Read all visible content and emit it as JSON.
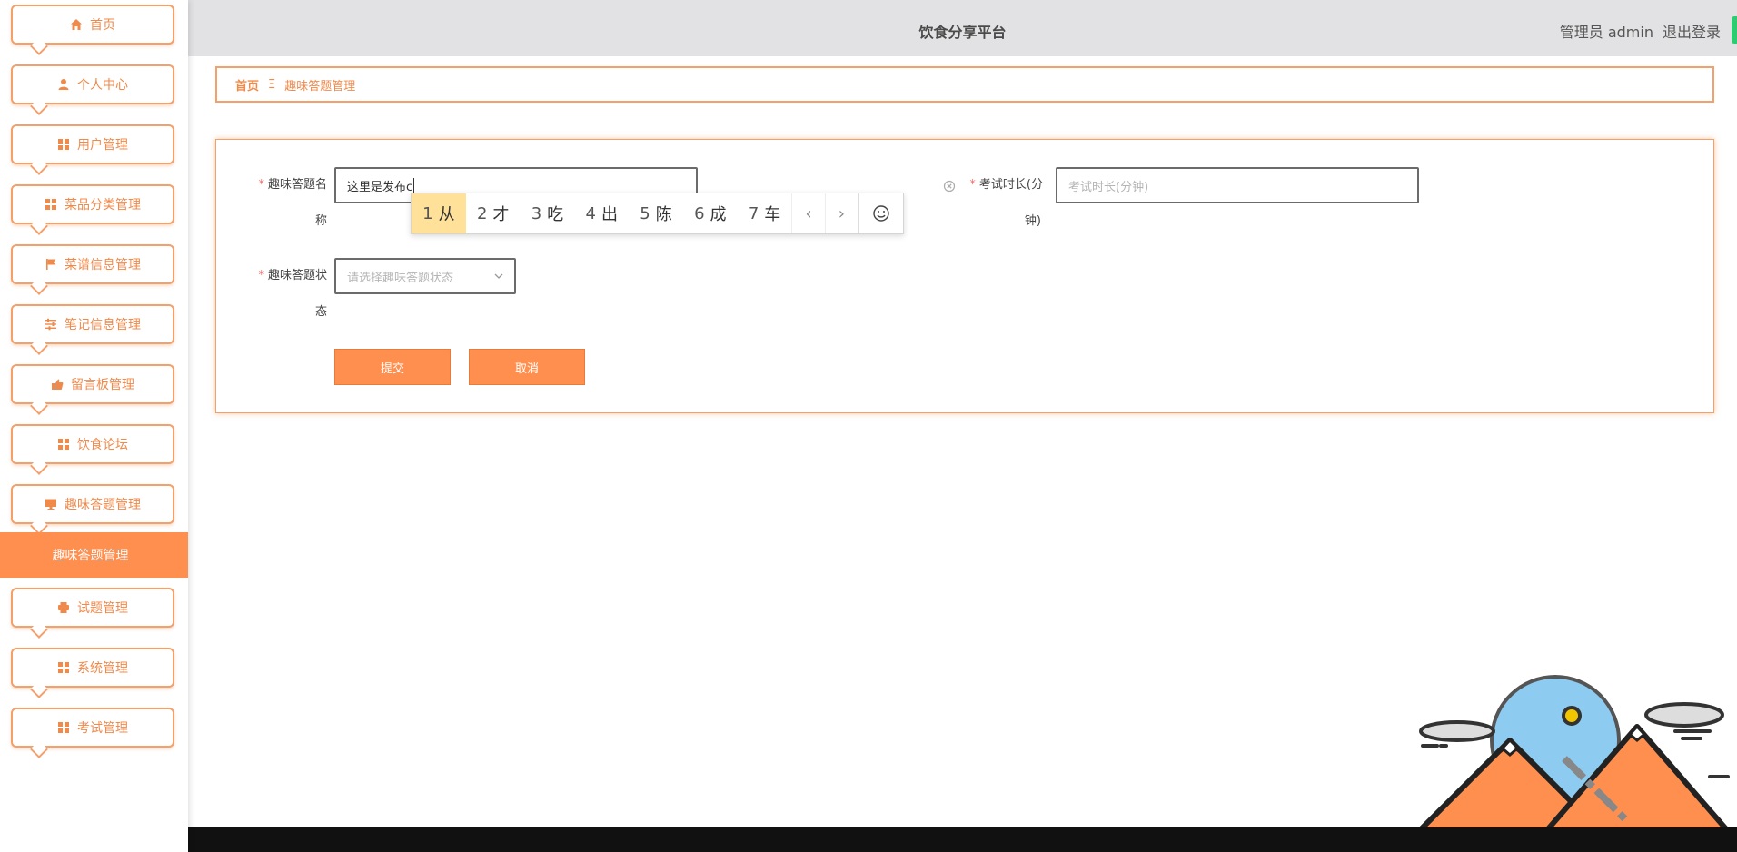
{
  "app": {
    "title": "饮食分享平台"
  },
  "user": {
    "role": "管理员",
    "name": "admin",
    "logout": "退出登录"
  },
  "sidebar": {
    "items": [
      {
        "label": "首页",
        "icon": "home-icon"
      },
      {
        "label": "个人中心",
        "icon": "person-icon"
      },
      {
        "label": "用户管理",
        "icon": "grid-icon"
      },
      {
        "label": "菜品分类管理",
        "icon": "grid-icon"
      },
      {
        "label": "菜谱信息管理",
        "icon": "flag-icon"
      },
      {
        "label": "笔记信息管理",
        "icon": "sliders-icon"
      },
      {
        "label": "留言板管理",
        "icon": "thumb-icon"
      },
      {
        "label": "饮食论坛",
        "icon": "grid-icon"
      },
      {
        "label": "趣味答题管理",
        "icon": "monitor-icon"
      }
    ],
    "active_sub": "趣味答题管理",
    "items_after": [
      {
        "label": "试题管理",
        "icon": "printer-icon"
      },
      {
        "label": "系统管理",
        "icon": "grid-icon"
      },
      {
        "label": "考试管理",
        "icon": "grid-icon"
      }
    ]
  },
  "breadcrumb": {
    "home": "首页",
    "separator": "Ξ",
    "current": "趣味答题管理"
  },
  "form": {
    "name_label_1": "趣味答题名",
    "name_label_2": "称",
    "name_value": "这里是发布c",
    "duration_label_1": "考试时长(分",
    "duration_label_2": "钟)",
    "duration_placeholder": "考试时长(分钟)",
    "status_label_1": "趣味答题状",
    "status_label_2": "态",
    "status_placeholder": "请选择趣味答题状态",
    "required_mark": "*",
    "submit": "提交",
    "cancel": "取消"
  },
  "ime": {
    "candidates": [
      {
        "n": "1",
        "c": "从"
      },
      {
        "n": "2",
        "c": "才"
      },
      {
        "n": "3",
        "c": "吃"
      },
      {
        "n": "4",
        "c": "出"
      },
      {
        "n": "5",
        "c": "陈"
      },
      {
        "n": "6",
        "c": "成"
      },
      {
        "n": "7",
        "c": "车"
      }
    ],
    "prev": "‹",
    "next": "›"
  },
  "colors": {
    "accent": "#ff8f4f",
    "accent_border": "#f3a06b",
    "header_bg": "#e2e2e4"
  }
}
